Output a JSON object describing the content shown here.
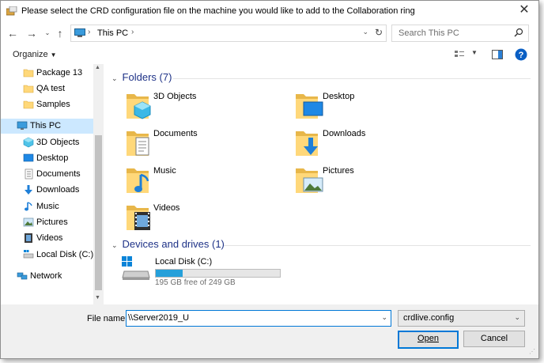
{
  "window": {
    "title": "Please select the CRD configuration file on the machine you would like to add to the Collaboration ring"
  },
  "address": {
    "crumb": "This PC",
    "search_placeholder": "Search This PC"
  },
  "toolbar": {
    "organize_label": "Organize"
  },
  "nav": {
    "items": [
      {
        "label": "Package 13",
        "icon": "folder-icon"
      },
      {
        "label": "QA test",
        "icon": "folder-icon"
      },
      {
        "label": "Samples",
        "icon": "folder-icon"
      },
      {
        "label": "This PC",
        "icon": "computer-icon",
        "selected": true
      },
      {
        "label": "3D Objects",
        "icon": "3d-objects-icon"
      },
      {
        "label": "Desktop",
        "icon": "desktop-icon"
      },
      {
        "label": "Documents",
        "icon": "documents-icon"
      },
      {
        "label": "Downloads",
        "icon": "downloads-icon"
      },
      {
        "label": "Music",
        "icon": "music-icon"
      },
      {
        "label": "Pictures",
        "icon": "pictures-icon"
      },
      {
        "label": "Videos",
        "icon": "videos-icon"
      },
      {
        "label": "Local Disk (C:)",
        "icon": "drive-icon"
      },
      {
        "label": "Network",
        "icon": "network-icon"
      }
    ]
  },
  "content": {
    "folders_header": "Folders (7)",
    "folders": [
      {
        "label": "3D Objects",
        "icon": "3d-objects-folder-icon"
      },
      {
        "label": "Desktop",
        "icon": "desktop-folder-icon"
      },
      {
        "label": "Documents",
        "icon": "documents-folder-icon"
      },
      {
        "label": "Downloads",
        "icon": "downloads-folder-icon"
      },
      {
        "label": "Music",
        "icon": "music-folder-icon"
      },
      {
        "label": "Pictures",
        "icon": "pictures-folder-icon"
      },
      {
        "label": "Videos",
        "icon": "videos-folder-icon"
      }
    ],
    "devices_header": "Devices and drives (1)",
    "drive": {
      "label": "Local Disk (C:)",
      "free_text": "195 GB free of 249 GB",
      "used_fraction": 0.217
    }
  },
  "footer": {
    "filename_label": "File name:",
    "filename_value": "\\\\Server2019_U",
    "filter_value": "crdlive.config",
    "open_label": "Open",
    "cancel_label": "Cancel"
  },
  "colors": {
    "accent": "#0078d7",
    "selection": "#cce8ff",
    "folder_yellow": "#ffd87a",
    "header_blue": "#1e3287",
    "drive_bar": "#26a0da"
  }
}
